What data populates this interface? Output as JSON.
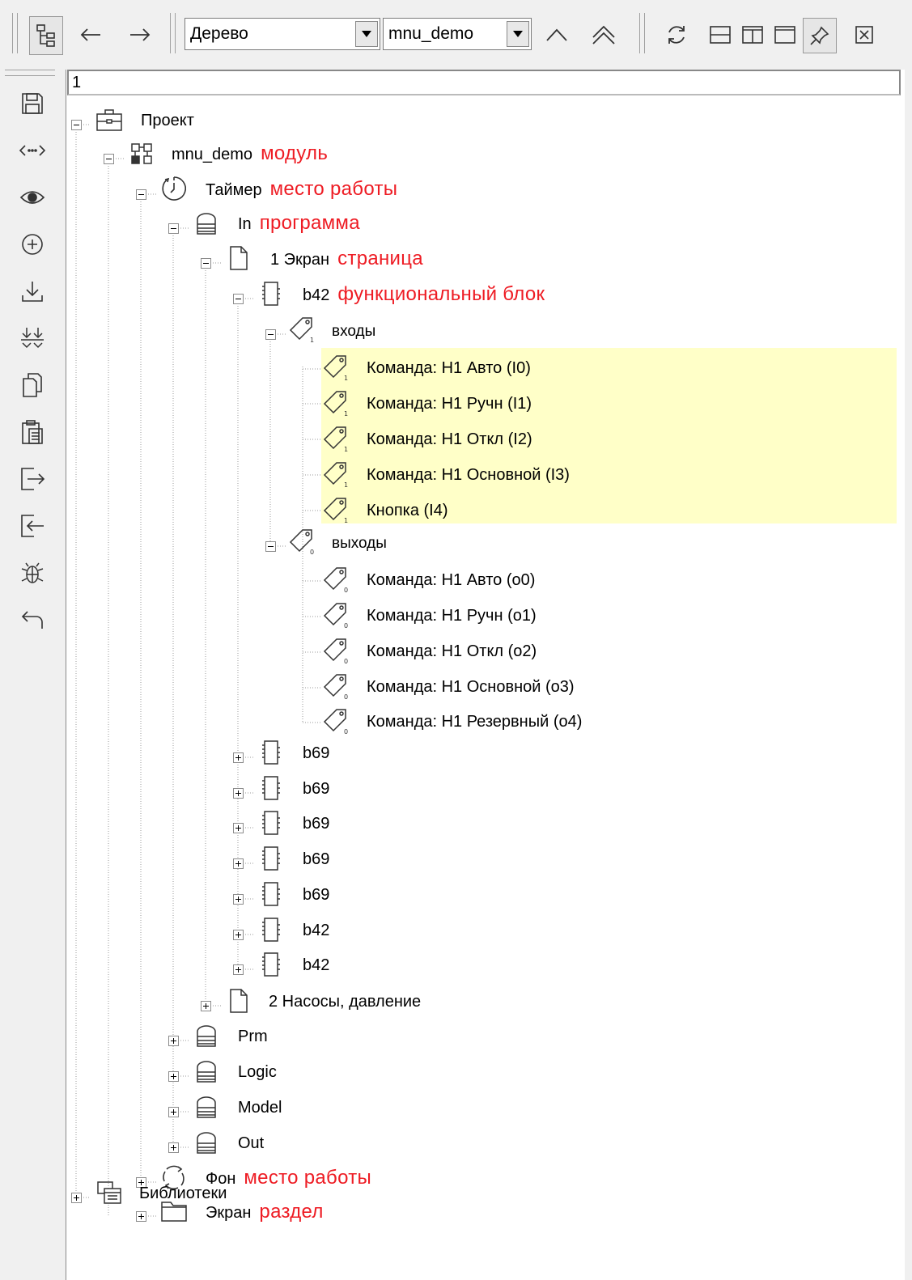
{
  "toolbar": {
    "view_select": "Дерево",
    "module_select": "mnu_demo"
  },
  "address": {
    "value": "1"
  },
  "tree": {
    "project": "Проект",
    "module": "mnu_demo",
    "module_anno": "модуль",
    "timer": "Таймер",
    "timer_anno": "место работы",
    "prog_in": "In",
    "prog_in_anno": "программа",
    "page1": "1 Экран",
    "page1_anno": "страница",
    "block_b42": "b42",
    "block_b42_anno": "функциональный блок",
    "inputs": "входы",
    "inputs_items": [
      "Команда: Н1 Авто  (I0)",
      "Команда: Н1 Ручн  (I1)",
      "Команда: Н1 Откл  (I2)",
      "Команда: Н1 Основной  (I3)",
      "Кнопка  (I4)"
    ],
    "outputs": "выходы",
    "outputs_items": [
      "Команда: Н1 Авто  (o0)",
      "Команда: Н1 Ручн  (o1)",
      "Команда: Н1 Откл  (o2)",
      "Команда: Н1 Основной  (o3)",
      "Команда: Н1 Резервный  (o4)"
    ],
    "blocks": [
      "b69",
      "b69",
      "b69",
      "b69",
      "b69",
      "b42",
      "b42"
    ],
    "page2": "2 Насосы, давление",
    "programs": [
      "Prm",
      "Logic",
      "Model",
      "Out"
    ],
    "fon": "Фон",
    "fon_anno": "место работы",
    "screen": "Экран",
    "screen_anno": "раздел",
    "libraries": "Библиотеки"
  },
  "colors": {
    "annotation": "#ee1c24",
    "highlight": "#ffffc8",
    "background": "#f0f0f0"
  },
  "icons": {
    "toolbar": [
      "tree-view-icon",
      "back-arrow-icon",
      "forward-arrow-icon",
      "chevron-up-icon",
      "double-chevron-up-icon",
      "refresh-icon",
      "layout-horizontal-icon",
      "layout-vertical-icon",
      "layout-single-icon",
      "pin-icon",
      "close-icon"
    ],
    "sidebar": [
      "save-icon",
      "code-icon",
      "eye-icon",
      "add-icon",
      "download-icon",
      "download-all-icon",
      "copy-icon",
      "paste-icon",
      "export-icon",
      "import-icon",
      "debug-icon",
      "undo-icon"
    ]
  }
}
